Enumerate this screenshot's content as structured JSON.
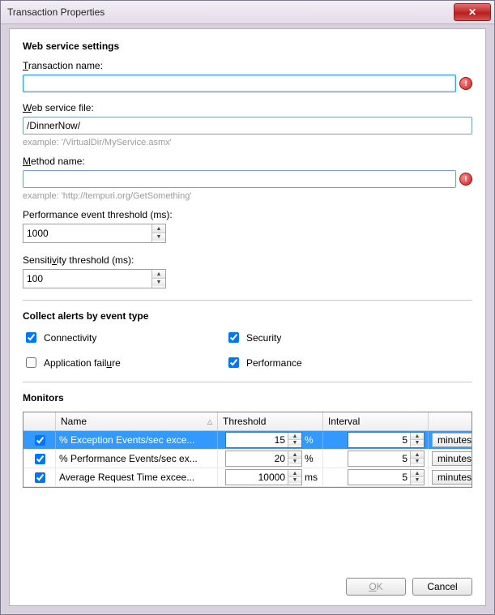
{
  "window": {
    "title": "Transaction Properties",
    "close_glyph": "✕"
  },
  "web_service": {
    "heading": "Web service settings",
    "transaction_name_label_pre": "T",
    "transaction_name_label_rest": "ransaction name:",
    "transaction_name_value": "",
    "error_glyph": "!",
    "web_service_file_label_pre": "W",
    "web_service_file_label_rest": "eb service file:",
    "web_service_file_value": "/DinnerNow/",
    "web_service_file_hint": "example: '/VirtualDir/MyService.asmx'",
    "method_name_label_pre": "M",
    "method_name_label_rest": "ethod name:",
    "method_name_value": "",
    "method_name_hint": "example: 'http://tempuri.org/GetSomething'",
    "perf_threshold_label": "Performance event threshold (ms):",
    "perf_threshold_value": "1000",
    "sensitivity_label_pre": "Sensiti",
    "sensitivity_label_u": "v",
    "sensitivity_label_post": "ity threshold (ms):",
    "sensitivity_value": "100"
  },
  "alerts": {
    "heading": "Collect alerts by event type",
    "connectivity_label": "Connectivity",
    "connectivity_checked": true,
    "security_label": "Security",
    "security_checked": true,
    "app_failure_label_pre": "Application fail",
    "app_failure_label_u": "u",
    "app_failure_label_post": "re",
    "app_failure_checked": false,
    "performance_label": "Performance",
    "performance_checked": true
  },
  "monitors": {
    "heading": "Monitors",
    "columns": {
      "name": "Name",
      "threshold": "Threshold",
      "interval": "Interval"
    },
    "unit_selected": "minutes",
    "rows": [
      {
        "checked": true,
        "name": "% Exception Events/sec exce...",
        "threshold": "15",
        "unit": "%",
        "interval": "5"
      },
      {
        "checked": true,
        "name": "% Performance Events/sec ex...",
        "threshold": "20",
        "unit": "%",
        "interval": "5"
      },
      {
        "checked": true,
        "name": "Average Request Time excee...",
        "threshold": "10000",
        "unit": "ms",
        "interval": "5"
      }
    ]
  },
  "footer": {
    "ok_label_u": "O",
    "ok_label_rest": "K",
    "cancel_label": "Cancel"
  }
}
